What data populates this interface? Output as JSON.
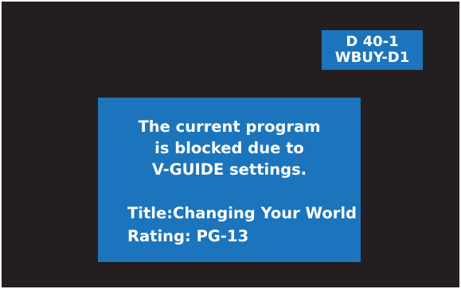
{
  "channel": {
    "number": "D 40-1",
    "station": "WBUY-D1"
  },
  "block_dialog": {
    "message_lines": [
      "The current program",
      "is blocked due to",
      "V-GUIDE settings."
    ],
    "title_label": "Title:",
    "title_value": "Changing Your World",
    "rating_label": "Rating:",
    "rating_value": "PG-13"
  },
  "colors": {
    "screen_background": "#231f20",
    "panel_blue": "#1c75bc",
    "text": "#ffffff"
  }
}
